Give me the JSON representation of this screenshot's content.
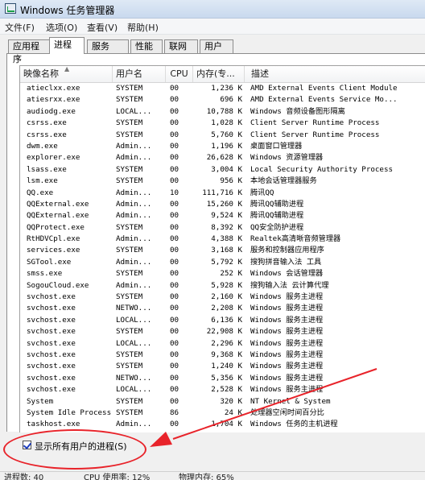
{
  "window": {
    "title": "Windows 任务管理器",
    "icon": "task-manager-icon"
  },
  "menu": [
    "文件(F)",
    "选项(O)",
    "查看(V)",
    "帮助(H)"
  ],
  "tabs": [
    {
      "label": "应用程序",
      "active": false
    },
    {
      "label": "进程",
      "active": true
    },
    {
      "label": "服务",
      "active": false
    },
    {
      "label": "性能",
      "active": false
    },
    {
      "label": "联网",
      "active": false
    },
    {
      "label": "用户",
      "active": false
    }
  ],
  "table": {
    "columns": [
      "映像名称",
      "用户名",
      "CPU",
      "内存(专...",
      "描述"
    ],
    "rows": [
      [
        "atieclxx.exe",
        "SYSTEM",
        "00",
        "1,236 K",
        "AMD External Events Client Module"
      ],
      [
        "atiesrxx.exe",
        "SYSTEM",
        "00",
        "696 K",
        "AMD External Events Service Mo..."
      ],
      [
        "audiodg.exe",
        "LOCAL...",
        "00",
        "10,788 K",
        "Windows 音频设备图形隔离"
      ],
      [
        "csrss.exe",
        "SYSTEM",
        "00",
        "1,028 K",
        "Client Server Runtime Process"
      ],
      [
        "csrss.exe",
        "SYSTEM",
        "00",
        "5,760 K",
        "Client Server Runtime Process"
      ],
      [
        "dwm.exe",
        "Admin...",
        "00",
        "1,196 K",
        "桌面窗口管理器"
      ],
      [
        "explorer.exe",
        "Admin...",
        "00",
        "26,628 K",
        "Windows 资源管理器"
      ],
      [
        "lsass.exe",
        "SYSTEM",
        "00",
        "3,004 K",
        "Local Security Authority Process"
      ],
      [
        "lsm.exe",
        "SYSTEM",
        "00",
        "956 K",
        "本地会话管理器服务"
      ],
      [
        "QQ.exe",
        "Admin...",
        "10",
        "111,716 K",
        "腾讯QQ"
      ],
      [
        "QQExternal.exe",
        "Admin...",
        "00",
        "15,260 K",
        "腾讯QQ辅助进程"
      ],
      [
        "QQExternal.exe",
        "Admin...",
        "00",
        "9,524 K",
        "腾讯QQ辅助进程"
      ],
      [
        "QQProtect.exe",
        "SYSTEM",
        "00",
        "8,392 K",
        "QQ安全防护进程"
      ],
      [
        "RtHDVCpl.exe",
        "Admin...",
        "00",
        "4,388 K",
        "Realtek高清晰音频管理器"
      ],
      [
        "services.exe",
        "SYSTEM",
        "00",
        "3,168 K",
        "服务和控制器应用程序"
      ],
      [
        "SGTool.exe",
        "Admin...",
        "00",
        "5,792 K",
        "搜狗拼音输入法 工具"
      ],
      [
        "smss.exe",
        "SYSTEM",
        "00",
        "252 K",
        "Windows 会话管理器"
      ],
      [
        "SogouCloud.exe",
        "Admin...",
        "00",
        "5,928 K",
        "搜狗输入法 云计算代理"
      ],
      [
        "svchost.exe",
        "SYSTEM",
        "00",
        "2,160 K",
        "Windows 服务主进程"
      ],
      [
        "svchost.exe",
        "NETWO...",
        "00",
        "2,208 K",
        "Windows 服务主进程"
      ],
      [
        "svchost.exe",
        "LOCAL...",
        "00",
        "6,136 K",
        "Windows 服务主进程"
      ],
      [
        "svchost.exe",
        "SYSTEM",
        "00",
        "22,908 K",
        "Windows 服务主进程"
      ],
      [
        "svchost.exe",
        "LOCAL...",
        "00",
        "2,296 K",
        "Windows 服务主进程"
      ],
      [
        "svchost.exe",
        "SYSTEM",
        "00",
        "9,368 K",
        "Windows 服务主进程"
      ],
      [
        "svchost.exe",
        "SYSTEM",
        "00",
        "1,240 K",
        "Windows 服务主进程"
      ],
      [
        "svchost.exe",
        "NETWO...",
        "00",
        "5,356 K",
        "Windows 服务主进程"
      ],
      [
        "svchost.exe",
        "LOCAL...",
        "00",
        "2,528 K",
        "Windows 服务主进程"
      ],
      [
        "System",
        "SYSTEM",
        "00",
        "320 K",
        "NT Kernel & System"
      ],
      [
        "System Idle Process",
        "SYSTEM",
        "86",
        "24 K",
        "处理器空闲时间百分比"
      ],
      [
        "taskhost.exe",
        "Admin...",
        "00",
        "1,704 K",
        "Windows 任务的主机进程"
      ]
    ]
  },
  "show_all_users": {
    "label": "显示所有用户的进程(S)",
    "checked": true
  },
  "annotation_color": "#e8232a",
  "statusbar": {
    "processes": "进程数: 40",
    "cpu": "CPU 使用率: 12%",
    "memory": "物理内存: 65%"
  }
}
